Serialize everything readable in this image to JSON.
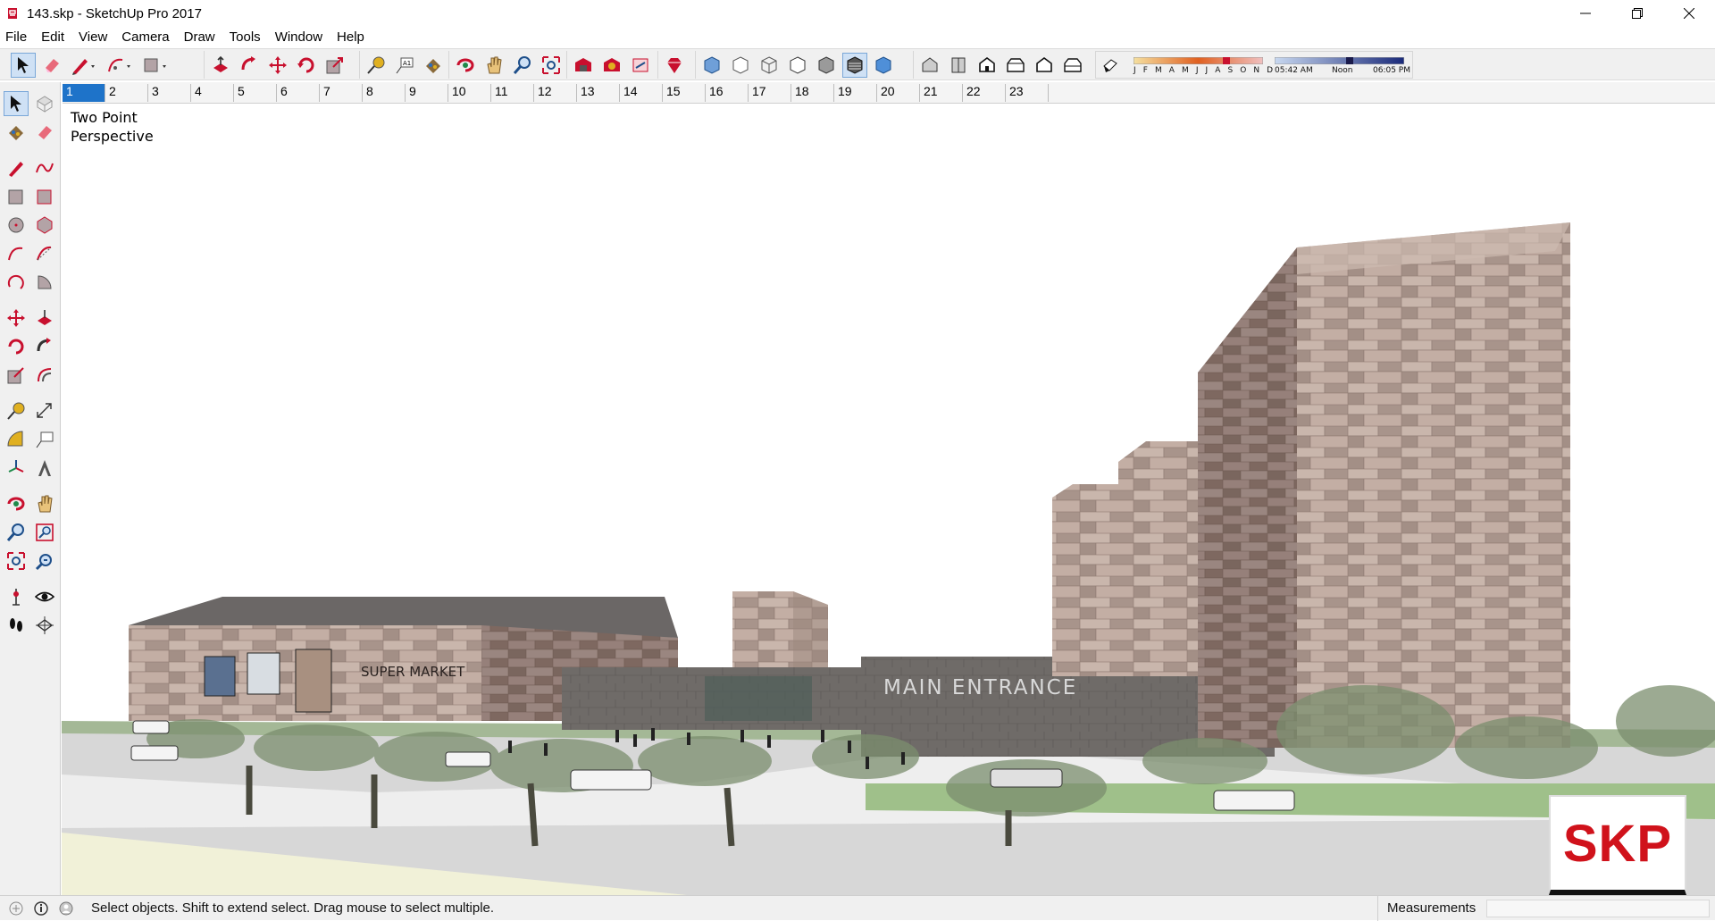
{
  "window": {
    "title": "143.skp - SketchUp Pro 2017"
  },
  "menu": [
    "File",
    "Edit",
    "View",
    "Camera",
    "Draw",
    "Tools",
    "Window",
    "Help"
  ],
  "toolbar": {
    "shadow_months": "J F M A M J J A S O N D",
    "time_start": "05:42 AM",
    "time_noon": "Noon",
    "time_end": "06:05 PM"
  },
  "scenes": [
    "1",
    "2",
    "3",
    "4",
    "5",
    "6",
    "7",
    "8",
    "9",
    "10",
    "11",
    "12",
    "13",
    "14",
    "15",
    "16",
    "17",
    "18",
    "19",
    "20",
    "21",
    "22",
    "23"
  ],
  "active_scene": "1",
  "viewport": {
    "camera_line1": "Two Point",
    "camera_line2": "Perspective",
    "sign_supermarket": "SUPER MARKET",
    "sign_entrance": "MAIN ENTRANCE",
    "badge": "SKP"
  },
  "status": {
    "message": "Select objects. Shift to extend select. Drag mouse to select multiple.",
    "measurements_label": "Measurements",
    "measurements_value": ""
  },
  "colors": {
    "accent": "#1e73c9",
    "skp_red": "#d0121b",
    "sketchup_red": "#c8102e"
  }
}
